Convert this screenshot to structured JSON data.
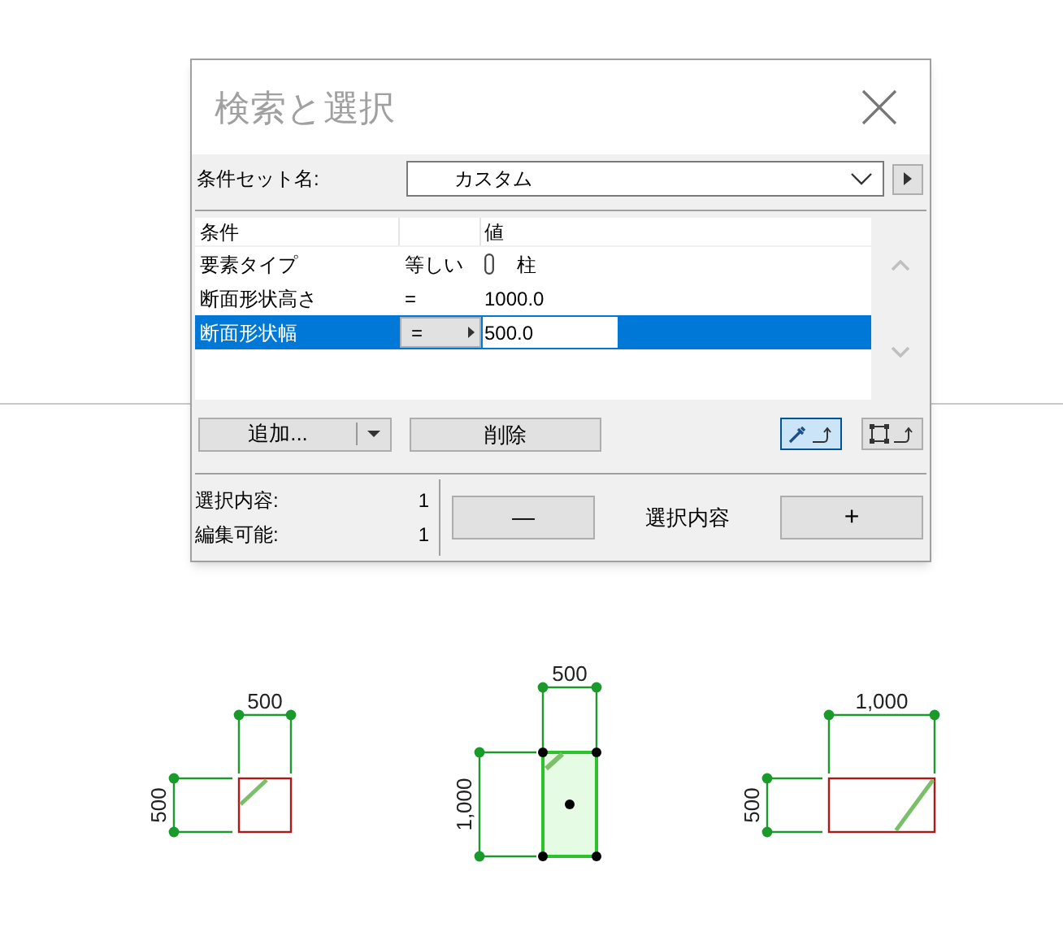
{
  "window": {
    "title": "検索と選択"
  },
  "criteria_set": {
    "label": "条件セット名:",
    "value": "カスタム"
  },
  "table": {
    "columns": [
      "条件",
      "値"
    ],
    "rows": [
      {
        "criterion": "要素タイプ",
        "operator": "等しい",
        "value": "柱",
        "kind": "element_type",
        "selected": false
      },
      {
        "criterion": "断面形状高さ",
        "operator": "=",
        "value": "1000.0",
        "kind": "number",
        "selected": false
      },
      {
        "criterion": "断面形状幅",
        "operator": "=",
        "value": "500.0",
        "kind": "number",
        "selected": true
      }
    ]
  },
  "buttons": {
    "add": "追加...",
    "delete": "削除"
  },
  "tool_buttons": [
    {
      "kind": "eyedropper",
      "selected": true
    },
    {
      "kind": "marquee",
      "selected": false
    }
  ],
  "summary": [
    {
      "label": "選択内容:",
      "value": "1"
    },
    {
      "label": "編集可能:",
      "value": "1"
    }
  ],
  "selection": {
    "minus": "—",
    "label": "選択内容",
    "plus": "+"
  },
  "plan_elements": [
    {
      "kind": "square",
      "width_label": "500",
      "height_label": "500",
      "selected": false
    },
    {
      "kind": "tall",
      "width_label": "500",
      "height_label": "1,000",
      "selected": true
    },
    {
      "kind": "wide",
      "width_label": "1,000",
      "height_label": "500",
      "selected": false
    }
  ]
}
